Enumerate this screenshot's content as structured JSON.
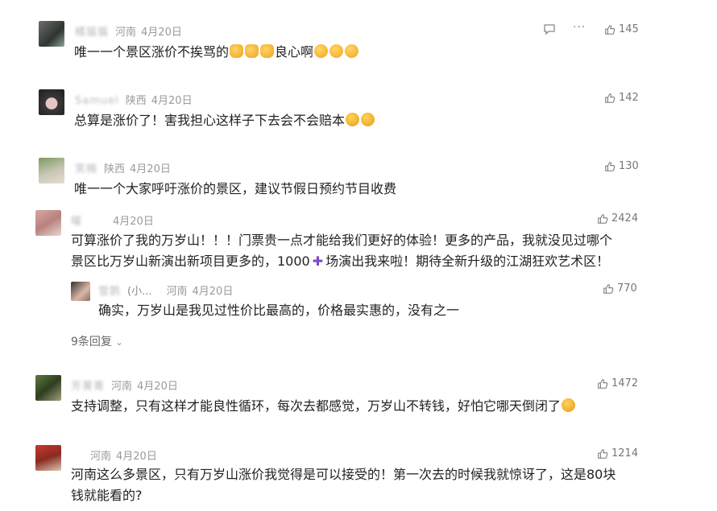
{
  "comments": [
    {
      "name": "橘猫猫",
      "location": "河南",
      "date": "4月20日",
      "likes": "145",
      "text": "唯一一个景区涨价不挨骂的",
      "text_tail": "良心啊"
    },
    {
      "name": "Samuel",
      "location": "陕西",
      "date": "4月20日",
      "likes": "142",
      "text": "总算是涨价了！害我担心这样子下去会不会赔本"
    },
    {
      "name": "笑楠",
      "location": "陕西",
      "date": "4月20日",
      "likes": "130",
      "text": "唯一一个大家呼吁涨价的景区，建议节假日预约节目收费"
    },
    {
      "name": "曜",
      "location": "",
      "date": "4月20日",
      "likes": "2424",
      "text_line1": "可算涨价了我的万岁山！！！门票贵一点才能给我们更好的体验！更多的产品，我就没见过哪个",
      "text_line2a": "景区比万岁山新演出新项目更多的，1000",
      "text_line2b": "场演出我来啦！期待全新升级的江湖狂欢艺术区！"
    },
    {
      "name": "芳菁菁",
      "location": "河南",
      "date": "4月20日",
      "likes": "1472",
      "text": "支持调整，只有这样才能良性循环，每次去都感觉，万岁山不转钱，好怕它哪天倒闭了"
    },
    {
      "name": "",
      "location": "河南",
      "date": "4月20日",
      "likes": "1214",
      "text_line1": "河南这么多景区，只有万岁山涨价我觉得是可以接受的！第一次去的时候我就惊讶了，这是80块",
      "text_line2": "钱就能看的?"
    }
  ],
  "reply": {
    "name": "雪鹊",
    "suffix": "(小...",
    "location": "河南",
    "date": "4月20日",
    "likes": "770",
    "text": "确实，万岁山是我见过性价比最高的，价格最实惠的，没有之一"
  },
  "more_replies": "9条回复",
  "icons": {
    "reply": "reply-icon",
    "more": "more-icon",
    "like": "thumb-up-icon"
  }
}
